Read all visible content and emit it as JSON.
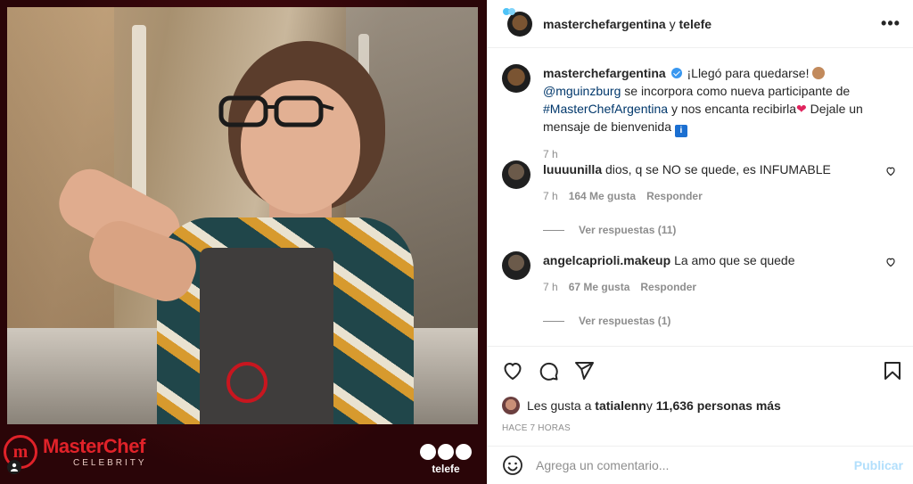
{
  "media": {
    "brand_title": "MasterChef",
    "brand_subtitle": "CELEBRITY",
    "brand_logo_letter": "m",
    "network": "telefe",
    "user_tag_icon": "user-icon"
  },
  "header": {
    "username": "masterchefargentina",
    "joiner": " y ",
    "collab": "telefe",
    "more_icon": "more-horizontal-icon",
    "more_glyph": "•••"
  },
  "caption": {
    "username": "masterchefargentina",
    "text_1": " ¡Llegó para quedarse! ",
    "mention": "@mguinzburg",
    "text_2": " se incorpora como nueva participante de ",
    "hashtag": "#MasterChefArgentina",
    "text_3": " y nos encanta recibirla",
    "heart": "❤",
    "text_4": " Dejale un mensaje de bienvenida",
    "info_glyph": "i",
    "time": "7 h"
  },
  "comments": [
    {
      "username": "luuuunilla",
      "text": "dios, q se NO se quede, es INFUMABLE",
      "time": "7 h",
      "likes": "164 Me gusta",
      "reply": "Responder",
      "view_replies": "Ver respuestas (11)"
    },
    {
      "username": "angelcaprioli.makeup",
      "text": "La amo que se quede",
      "time": "7 h",
      "likes": "67 Me gusta",
      "reply": "Responder",
      "view_replies": "Ver respuestas (1)"
    }
  ],
  "likes": {
    "prefix": "Les gusta a ",
    "user": "tatialenn",
    "middle": " y ",
    "count": "11,636 personas más"
  },
  "posted_ago": "HACE 7 HORAS",
  "composer": {
    "placeholder": "Agrega un comentario...",
    "publish": "Publicar"
  },
  "icons": [
    "heart-icon",
    "comment-icon",
    "share-icon",
    "bookmark-icon",
    "emoji-icon"
  ],
  "colors": {
    "link": "#00376b",
    "verified": "#3897f0",
    "publish_disabled": "#b2dffc",
    "brand_red": "#e02229"
  }
}
